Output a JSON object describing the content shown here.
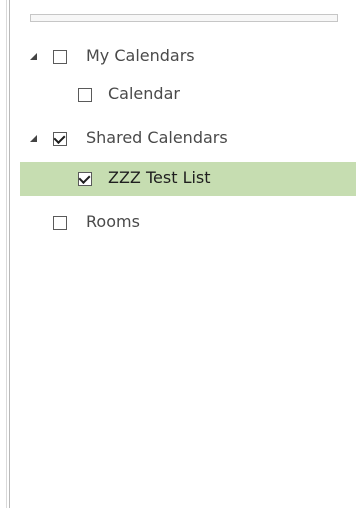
{
  "tree": {
    "items": [
      {
        "label": "My Calendars",
        "checked": false,
        "expanded": true,
        "has_expander": true,
        "selected": false
      },
      {
        "label": "Calendar",
        "checked": false,
        "has_expander": false,
        "selected": false
      },
      {
        "label": "Shared Calendars",
        "checked": true,
        "expanded": true,
        "has_expander": true,
        "selected": false
      },
      {
        "label": "ZZZ Test List",
        "checked": true,
        "has_expander": false,
        "selected": true
      },
      {
        "label": "Rooms",
        "checked": false,
        "has_expander": false,
        "selected": false
      }
    ]
  },
  "colors": {
    "selection": "#c6ddb1",
    "text": "#4a4a4a",
    "text_active": "#1f1f1f",
    "checkbox_border": "#5a5a5a"
  }
}
